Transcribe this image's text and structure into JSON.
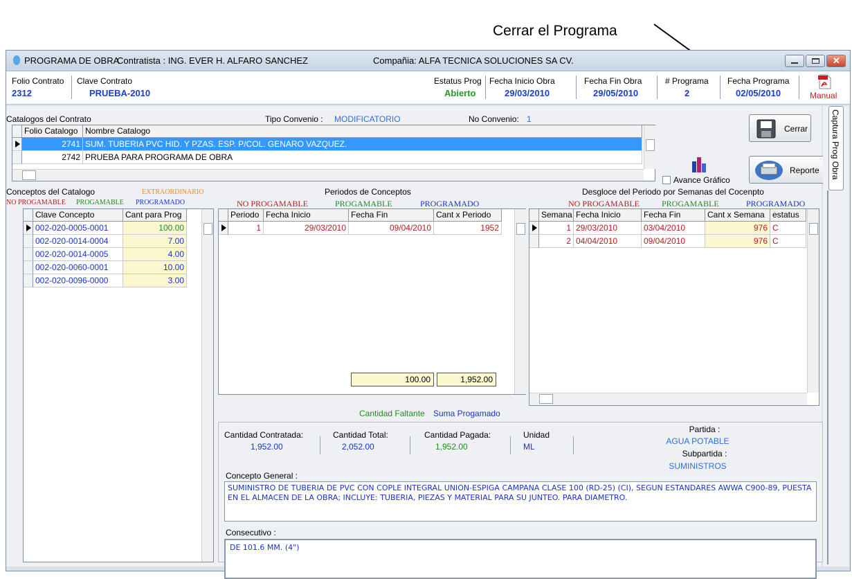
{
  "annotation": {
    "top_fragment": "",
    "label": "Cerrar el Programa"
  },
  "window": {
    "title": "PROGRAMA DE OBRA",
    "contratista": "Contratista : ING. EVER H. ALFARO SANCHEZ",
    "compania": "Compañia: ALFA TECNICA SOLUCIONES SA CV."
  },
  "header": {
    "folio_label": "Folio Contrato",
    "folio_value": "2312",
    "clave_label": "Clave Contrato",
    "clave_value": "PRUEBA-2010",
    "estatus_label": "Estatus Prog",
    "estatus_value": "Abierto",
    "inicio_label": "Fecha Inicio Obra",
    "inicio_value": "29/03/2010",
    "fin_label": "Fecha Fin Obra",
    "fin_value": "29/05/2010",
    "programa_label": "# Programa",
    "programa_value": "2",
    "fprog_label": "Fecha Programa",
    "fprog_value": "02/05/2010",
    "manual_label": "Manual"
  },
  "catalogos": {
    "title": "Catalogos del Contrato",
    "tipo_label": "Tipo Convenio :",
    "tipo_value": "MODIFICATORIO",
    "conv_label": "No Convenio:",
    "conv_value": "1",
    "columns": [
      "Folio Catalogo",
      "Nombre Catalogo"
    ],
    "rows": [
      {
        "folio": "2741",
        "nombre": "SUM. TUBERIA PVC HID. Y PZAS. ESP. P/COL. GENARO VAZQUEZ."
      },
      {
        "folio": "2742",
        "nombre": "PRUEBA PARA PROGRAMA DE OBRA"
      }
    ]
  },
  "buttons": {
    "cerrar": "Cerrar",
    "reporte": "Reporte",
    "avance": "Avance Gráfico",
    "side_tab": "Captura Prog Obra"
  },
  "conceptos": {
    "title": "Conceptos del Catalogo",
    "extra": "EXTRAORDINARIO",
    "legend_np": "NO PROGAMABLE",
    "legend_p": "PROGAMABLE",
    "legend_pr": "PROGRAMADO",
    "columns": [
      "Clave Concepto",
      "Cant para Prog"
    ],
    "rows": [
      {
        "clave": "002-020-0005-0001",
        "cant": "100.00"
      },
      {
        "clave": "002-020-0014-0004",
        "cant": "7.00"
      },
      {
        "clave": "002-020-0014-0005",
        "cant": "4.00"
      },
      {
        "clave": "002-020-0060-0001",
        "cant": "10.00"
      },
      {
        "clave": "002-020-0096-0000",
        "cant": "3.00"
      }
    ]
  },
  "periodos": {
    "title": "Periodos de Conceptos",
    "legend_np": "NO PROGAMABLE",
    "legend_p": "PROGAMABLE",
    "legend_pr": "PROGRAMADO",
    "columns": [
      "Periodo",
      "Fecha Inicio",
      "Fecha Fin",
      "Cant x Periodo"
    ],
    "rows": [
      {
        "periodo": "1",
        "inicio": "29/03/2010",
        "fin": "09/04/2010",
        "cant": "1952"
      }
    ],
    "faltante_value": "100.00",
    "suma_value": "1,952.00",
    "faltante_label": "Cantidad Faltante",
    "suma_label": "Suma Progamado"
  },
  "desglose": {
    "title": "Desgloce del Periodo por Semanas del Cocenpto",
    "legend_np": "NO PROGAMABLE",
    "legend_p": "PROGAMABLE",
    "legend_pr": "PROGRAMADO",
    "columns": [
      "Semana",
      "Fecha Inicio",
      "Fecha Fin",
      "Cant x Semana",
      "estatus"
    ],
    "rows": [
      {
        "semana": "1",
        "inicio": "29/03/2010",
        "fin": "03/04/2010",
        "cant": "976",
        "estatus": "C"
      },
      {
        "semana": "2",
        "inicio": "04/04/2010",
        "fin": "09/04/2010",
        "cant": "976",
        "estatus": "C"
      }
    ]
  },
  "info": {
    "contratada_label": "Cantidad Contratada:",
    "contratada_value": "1,952.00",
    "total_label": "Cantidad Total:",
    "total_value": "2,052.00",
    "pagada_label": "Cantidad Pagada:",
    "pagada_value": "1,952.00",
    "unidad_label": "Unidad",
    "unidad_value": "ML",
    "partida_label": "Partida :",
    "partida_value": "AGUA POTABLE",
    "subpartida_label": "Subpartida :",
    "subpartida_value": "SUMINISTROS",
    "concepto_label": "Concepto General :",
    "concepto_text": "SUMINISTRO DE TUBERIA DE PVC CON COPLE INTEGRAL UNION-ESPIGA CAMPANA CLASE 100 (RD-25) (CI), SEGUN ESTANDARES AWWA C900-89, PUESTA EN EL ALMACEN DE LA OBRA; INCLUYE: TUBERIA, PIEZAS Y  MATERIAL PARA SU JUNTEO. PARA DIAMETRO.",
    "consecutivo_label": "Consecutivo :",
    "consecutivo_text": "DE 101.6 MM. (4\")"
  },
  "colors": {
    "selection": "#3399ff",
    "accent_blue": "#1a33c8",
    "green": "#228a22",
    "red": "#b21e1e",
    "yellow_cell": "#fdf7cf"
  }
}
